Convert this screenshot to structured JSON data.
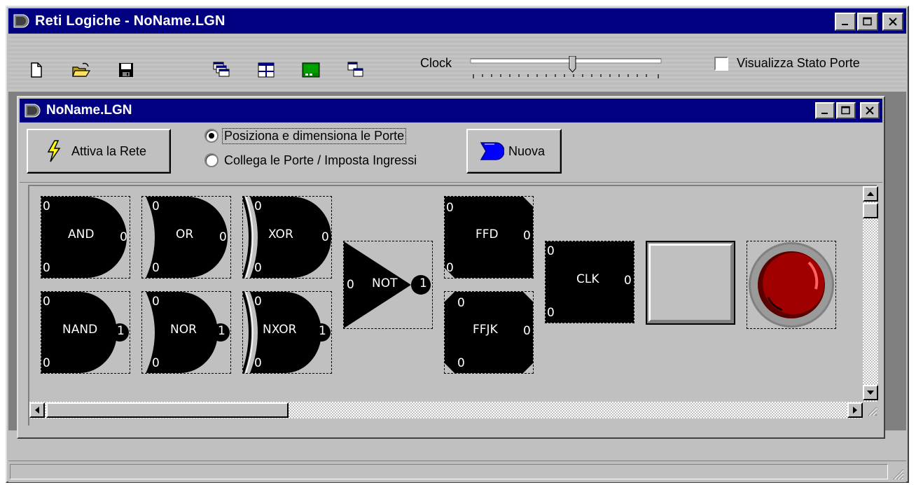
{
  "app": {
    "title": "Reti Logiche - NoName.LGN"
  },
  "toolbar": {
    "clock_label": "Clock",
    "show_state_label": "Visualizza Stato Porte"
  },
  "child": {
    "title": "NoName.LGN",
    "activate_label": "Attiva la Rete",
    "mode_position_label": "Posiziona e dimensiona le Porte",
    "mode_connect_label": "Collega le Porte / Imposta Ingressi",
    "new_label": "Nuova"
  },
  "gates": {
    "and": {
      "label": "AND",
      "in1": "0",
      "in2": "0",
      "out": "0"
    },
    "or": {
      "label": "OR",
      "in1": "0",
      "in2": "0",
      "out": "0"
    },
    "xor": {
      "label": "XOR",
      "in1": "0",
      "in2": "0",
      "out": "0"
    },
    "nand": {
      "label": "NAND",
      "in1": "0",
      "in2": "0",
      "out": "1"
    },
    "nor": {
      "label": "NOR",
      "in1": "0",
      "in2": "0",
      "out": "1"
    },
    "nxor": {
      "label": "NXOR",
      "in1": "0",
      "in2": "0",
      "out": "1"
    },
    "not": {
      "label": "NOT",
      "in1": "0",
      "out": "1"
    },
    "ffd": {
      "label": "FFD",
      "in1": "0",
      "in2": "0",
      "out": "0"
    },
    "ffjk": {
      "label": "FFJK",
      "in1": "0",
      "in2": "0",
      "out": "0"
    },
    "clk": {
      "label": "CLK",
      "in1": "0",
      "in2": "0",
      "out": "0"
    }
  }
}
